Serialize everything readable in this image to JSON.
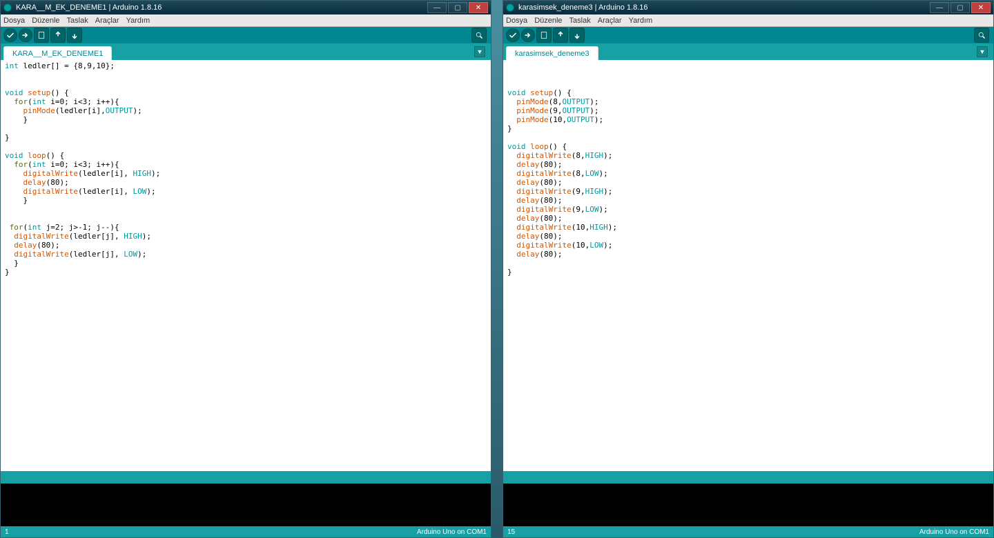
{
  "w1": {
    "title": "KARA__M_EK_DENEME1 | Arduino 1.8.16",
    "menus": [
      "Dosya",
      "Düzenle",
      "Taslak",
      "Araçlar",
      "Yardım"
    ],
    "tab": "KARA__M_EK_DENEME1",
    "status_left": "1",
    "status_right": "Arduino Uno on COM1",
    "code_tokens": [
      [
        [
          "k-type",
          "int"
        ],
        [
          "",
          " ledler[] = {8,9,10};"
        ]
      ],
      [],
      [],
      [
        [
          "k-type",
          "void"
        ],
        [
          "",
          " "
        ],
        [
          "k-fn",
          "setup"
        ],
        [
          "",
          "() {"
        ]
      ],
      [
        [
          "",
          "  "
        ],
        [
          "k-kw",
          "for"
        ],
        [
          "",
          "("
        ],
        [
          "k-type",
          "int"
        ],
        [
          "",
          " i=0; i<3; i++){"
        ]
      ],
      [
        [
          "",
          "    "
        ],
        [
          "k-fn",
          "pinMode"
        ],
        [
          "",
          "(ledler[i],"
        ],
        [
          "k-const",
          "OUTPUT"
        ],
        [
          "",
          ");"
        ]
      ],
      [
        [
          "",
          "    }"
        ]
      ],
      [],
      [
        [
          "",
          "}"
        ]
      ],
      [],
      [
        [
          "k-type",
          "void"
        ],
        [
          "",
          " "
        ],
        [
          "k-fn",
          "loop"
        ],
        [
          "",
          "() {"
        ]
      ],
      [
        [
          "",
          "  "
        ],
        [
          "k-kw",
          "for"
        ],
        [
          "",
          "("
        ],
        [
          "k-type",
          "int"
        ],
        [
          "",
          " i=0; i<3; i++){"
        ]
      ],
      [
        [
          "",
          "    "
        ],
        [
          "k-fn",
          "digitalWrite"
        ],
        [
          "",
          "(ledler[i], "
        ],
        [
          "k-const",
          "HIGH"
        ],
        [
          "",
          ");"
        ]
      ],
      [
        [
          "",
          "    "
        ],
        [
          "k-fn",
          "delay"
        ],
        [
          "",
          "(80);"
        ]
      ],
      [
        [
          "",
          "    "
        ],
        [
          "k-fn",
          "digitalWrite"
        ],
        [
          "",
          "(ledler[i], "
        ],
        [
          "k-const",
          "LOW"
        ],
        [
          "",
          ");"
        ]
      ],
      [
        [
          "",
          "    }"
        ]
      ],
      [],
      [],
      [
        [
          "",
          " "
        ],
        [
          "k-kw",
          "for"
        ],
        [
          "",
          "("
        ],
        [
          "k-type",
          "int"
        ],
        [
          "",
          " j=2; j>-1; j--){"
        ]
      ],
      [
        [
          "",
          "  "
        ],
        [
          "k-fn",
          "digitalWrite"
        ],
        [
          "",
          "(ledler[j], "
        ],
        [
          "k-const",
          "HIGH"
        ],
        [
          "",
          ");"
        ]
      ],
      [
        [
          "",
          "  "
        ],
        [
          "k-fn",
          "delay"
        ],
        [
          "",
          "(80);"
        ]
      ],
      [
        [
          "",
          "  "
        ],
        [
          "k-fn",
          "digitalWrite"
        ],
        [
          "",
          "(ledler[j], "
        ],
        [
          "k-const",
          "LOW"
        ],
        [
          "",
          ");"
        ]
      ],
      [
        [
          "",
          "  }"
        ]
      ],
      [
        [
          "",
          "}"
        ]
      ]
    ]
  },
  "w2": {
    "title": "karasimsek_deneme3 | Arduino 1.8.16",
    "menus": [
      "Dosya",
      "Düzenle",
      "Taslak",
      "Araçlar",
      "Yardım"
    ],
    "tab": "karasimsek_deneme3",
    "status_left": "15",
    "status_right": "Arduino Uno on COM1",
    "code_tokens": [
      [],
      [],
      [],
      [
        [
          "k-type",
          "void"
        ],
        [
          "",
          " "
        ],
        [
          "k-fn",
          "setup"
        ],
        [
          "",
          "() {"
        ]
      ],
      [
        [
          "",
          "  "
        ],
        [
          "k-fn",
          "pinMode"
        ],
        [
          "",
          "(8,"
        ],
        [
          "k-const",
          "OUTPUT"
        ],
        [
          "",
          ");"
        ]
      ],
      [
        [
          "",
          "  "
        ],
        [
          "k-fn",
          "pinMode"
        ],
        [
          "",
          "(9,"
        ],
        [
          "k-const",
          "OUTPUT"
        ],
        [
          "",
          ");"
        ]
      ],
      [
        [
          "",
          "  "
        ],
        [
          "k-fn",
          "pinMode"
        ],
        [
          "",
          "(10,"
        ],
        [
          "k-const",
          "OUTPUT"
        ],
        [
          "",
          ");"
        ]
      ],
      [
        [
          "",
          "}"
        ]
      ],
      [],
      [
        [
          "k-type",
          "void"
        ],
        [
          "",
          " "
        ],
        [
          "k-fn",
          "loop"
        ],
        [
          "",
          "() {"
        ]
      ],
      [
        [
          "",
          "  "
        ],
        [
          "k-fn",
          "digitalWrite"
        ],
        [
          "",
          "(8,"
        ],
        [
          "k-const",
          "HIGH"
        ],
        [
          "",
          ");"
        ]
      ],
      [
        [
          "",
          "  "
        ],
        [
          "k-fn",
          "delay"
        ],
        [
          "",
          "(80);"
        ]
      ],
      [
        [
          "",
          "  "
        ],
        [
          "k-fn",
          "digitalWrite"
        ],
        [
          "",
          "(8,"
        ],
        [
          "k-const",
          "LOW"
        ],
        [
          "",
          ");"
        ]
      ],
      [
        [
          "",
          "  "
        ],
        [
          "k-fn",
          "delay"
        ],
        [
          "",
          "(80);"
        ]
      ],
      [
        [
          "",
          "  "
        ],
        [
          "k-fn",
          "digitalWrite"
        ],
        [
          "",
          "(9,"
        ],
        [
          "k-const",
          "HIGH"
        ],
        [
          "",
          ");"
        ]
      ],
      [
        [
          "",
          "  "
        ],
        [
          "k-fn",
          "delay"
        ],
        [
          "",
          "(80);"
        ]
      ],
      [
        [
          "",
          "  "
        ],
        [
          "k-fn",
          "digitalWrite"
        ],
        [
          "",
          "(9,"
        ],
        [
          "k-const",
          "LOW"
        ],
        [
          "",
          ");"
        ]
      ],
      [
        [
          "",
          "  "
        ],
        [
          "k-fn",
          "delay"
        ],
        [
          "",
          "(80);"
        ]
      ],
      [
        [
          "",
          "  "
        ],
        [
          "k-fn",
          "digitalWrite"
        ],
        [
          "",
          "(10,"
        ],
        [
          "k-const",
          "HIGH"
        ],
        [
          "",
          ");"
        ]
      ],
      [
        [
          "",
          "  "
        ],
        [
          "k-fn",
          "delay"
        ],
        [
          "",
          "(80);"
        ]
      ],
      [
        [
          "",
          "  "
        ],
        [
          "k-fn",
          "digitalWrite"
        ],
        [
          "",
          "(10,"
        ],
        [
          "k-const",
          "LOW"
        ],
        [
          "",
          ");"
        ]
      ],
      [
        [
          "",
          "  "
        ],
        [
          "k-fn",
          "delay"
        ],
        [
          "",
          "(80);"
        ]
      ],
      [],
      [
        [
          "",
          "}"
        ]
      ]
    ]
  }
}
